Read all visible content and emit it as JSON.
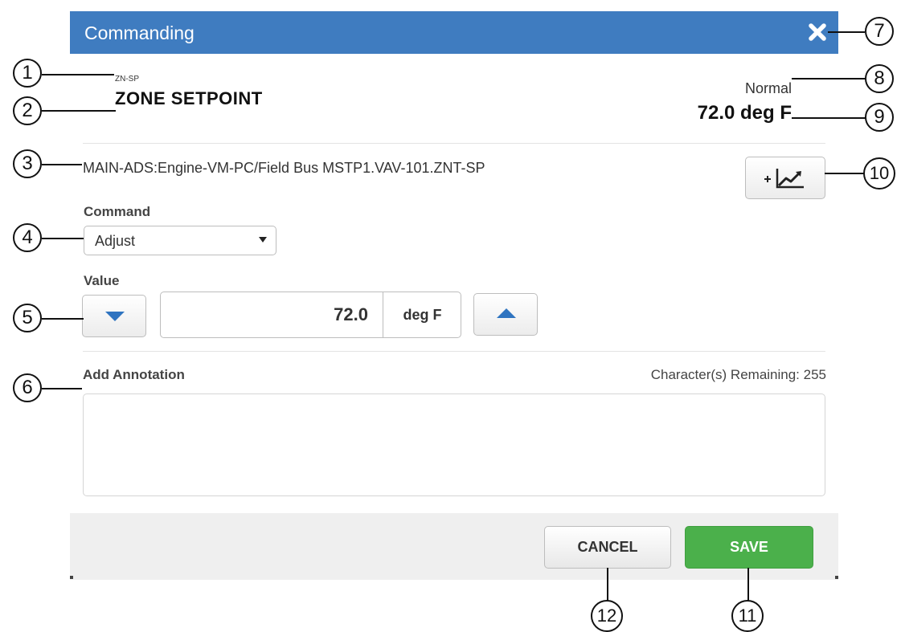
{
  "dialog": {
    "title": "Commanding",
    "point_abbreviation": "ZN-SP",
    "point_name": "ZONE SETPOINT",
    "status": "Normal",
    "present_value": "72.0 deg F",
    "object_path": "MAIN-ADS:Engine-VM-PC/Field Bus MSTP1.VAV-101.ZNT-SP"
  },
  "command": {
    "label": "Command",
    "selected": "Adjust"
  },
  "value": {
    "label": "Value",
    "amount": "72.0",
    "unit": "deg F"
  },
  "annotation": {
    "label": "Add Annotation",
    "remaining_text": "Character(s) Remaining: 255",
    "text": ""
  },
  "footer": {
    "cancel_label": "CANCEL",
    "save_label": "SAVE"
  },
  "callouts": [
    "1",
    "2",
    "3",
    "4",
    "5",
    "6",
    "7",
    "8",
    "9",
    "10",
    "11",
    "12"
  ],
  "colors": {
    "titlebar": "#3f7cc0",
    "save_button": "#4bb04b",
    "arrow": "#2f74c0"
  }
}
